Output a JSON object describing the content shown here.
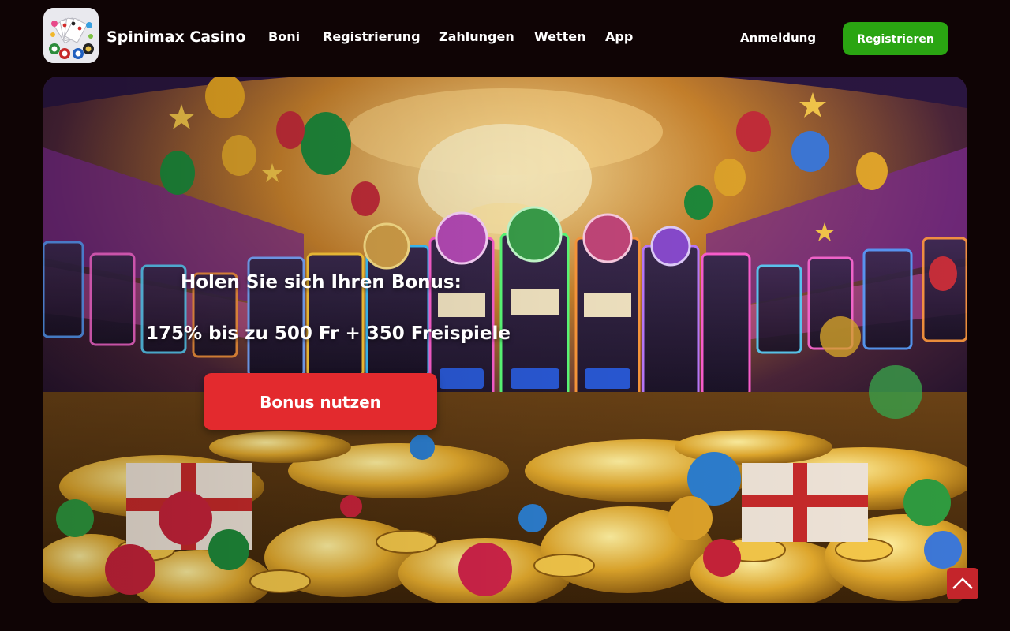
{
  "brand": {
    "name": "Spinimax Casino",
    "logo_icon": "casino-cards-logo-icon"
  },
  "nav": {
    "items": [
      {
        "label": "Boni"
      },
      {
        "label": "Registrierung"
      },
      {
        "label": "Zahlungen"
      },
      {
        "label": "Wetten"
      },
      {
        "label": "App"
      }
    ]
  },
  "header": {
    "login_label": "Anmeldung",
    "register_label": "Registrieren"
  },
  "hero": {
    "title": "Holen Sie sich Ihren Bonus:",
    "offer": "175% bis zu 500 Fr + 350 Freispiele",
    "cta_label": "Bonus nutzen",
    "background_icon": "casino-slot-machines-coins-image"
  },
  "back_to_top": {
    "icon": "chevron-up-icon"
  },
  "colors": {
    "page_background": "#0f0405",
    "register_button": "#2aa512",
    "cta_button": "#e32a2e",
    "back_to_top": "#c4252b"
  }
}
